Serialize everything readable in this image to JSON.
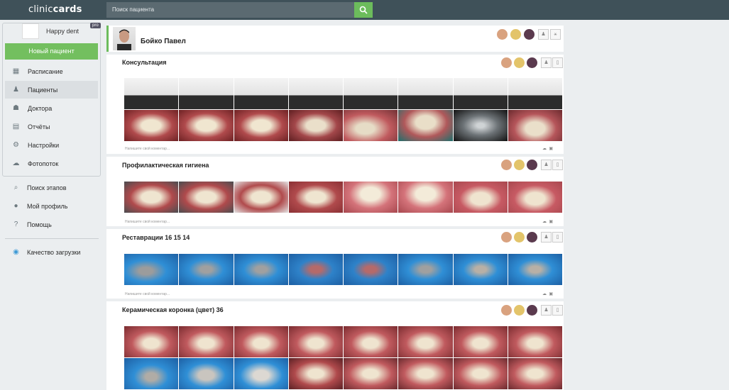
{
  "app": {
    "logo_a": "clinic",
    "logo_b": "cards",
    "search_placeholder": "Поиск пациента"
  },
  "clinic": {
    "name": "Happy dent",
    "badge": "pro"
  },
  "sidebar": {
    "new_patient": "Новый пациент",
    "items": [
      {
        "label": "Расписание",
        "icon": "calendar-icon"
      },
      {
        "label": "Пациенты",
        "icon": "patient-icon"
      },
      {
        "label": "Доктора",
        "icon": "doctors-icon"
      },
      {
        "label": "Отчёты",
        "icon": "reports-icon"
      },
      {
        "label": "Настройки",
        "icon": "settings-icon"
      },
      {
        "label": "Фотопоток",
        "icon": "cloud-icon"
      }
    ],
    "secondary": [
      {
        "label": "Поиск этапов",
        "icon": "search-icon"
      },
      {
        "label": "Мой профиль",
        "icon": "user-icon"
      },
      {
        "label": "Помощь",
        "icon": "help-icon"
      },
      {
        "label": "Качество загрузки",
        "icon": "radio-icon"
      }
    ]
  },
  "patient": {
    "name": "Бойко Павел"
  },
  "sections": [
    {
      "title": "Консультация",
      "comment": "Напишите свой коментар..."
    },
    {
      "title": "Профилактическая гигиена",
      "comment": "Напишите свой коментар..."
    },
    {
      "title": "Реставрации 16 15 14",
      "comment": "Напишите свой коментар..."
    },
    {
      "title": "Керамическая коронка (цвет) 36",
      "comment": ""
    }
  ]
}
